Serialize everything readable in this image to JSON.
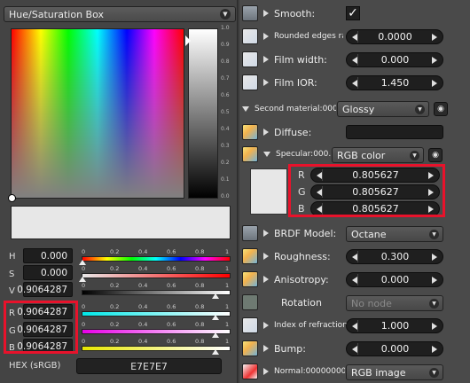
{
  "left": {
    "mode_dropdown": "Hue/Saturation Box",
    "value_ticks": [
      "1.0",
      "0.9",
      "0.8",
      "0.7",
      "0.6",
      "0.5",
      "0.4",
      "0.3",
      "0.2",
      "0.1",
      "0.0"
    ],
    "slider_ticks": [
      "0",
      "0.2",
      "0.4",
      "0.6",
      "0.8",
      "1"
    ],
    "rows": [
      {
        "label": "H",
        "value": "0.000",
        "fraction": 0.0
      },
      {
        "label": "S",
        "value": "0.000",
        "fraction": 0.0
      },
      {
        "label": "V",
        "value": "0.9064287",
        "fraction": 0.906
      },
      {
        "label": "R",
        "value": "0.9064287",
        "fraction": 0.906
      },
      {
        "label": "G",
        "value": "0.9064287",
        "fraction": 0.906
      },
      {
        "label": "B",
        "value": "0.9064287",
        "fraction": 0.906
      }
    ],
    "hex_label": "HEX (sRGB)",
    "hex_value": "E7E7E7",
    "preview_color": "#e7e7e7"
  },
  "right": {
    "smooth": {
      "label": "Smooth:",
      "checked": "✓"
    },
    "rounded_edges": {
      "label": "Rounded edges ra...",
      "value": "0.0000"
    },
    "film_width": {
      "label": "Film width:",
      "value": "0.000"
    },
    "film_ior": {
      "label": "Film IOR:",
      "value": "1.450"
    },
    "second_material": {
      "label": "Second material:0000...",
      "value": "Glossy"
    },
    "diffuse": {
      "label": "Diffuse:"
    },
    "specular": {
      "label": "Specular:000...",
      "value": "RGB color",
      "swatch_color": "#e7e7e7",
      "channels": [
        {
          "label": "R",
          "value": "0.805627"
        },
        {
          "label": "G",
          "value": "0.805627"
        },
        {
          "label": "B",
          "value": "0.805627"
        }
      ]
    },
    "brdf_model": {
      "label": "BRDF Model:",
      "value": "Octane"
    },
    "roughness": {
      "label": "Roughness:",
      "value": "0.300"
    },
    "anisotropy": {
      "label": "Anisotropy:",
      "value": "0.000"
    },
    "rotation": {
      "label": "Rotation",
      "value": "No node"
    },
    "index_of_refraction": {
      "label": "Index of refraction:",
      "value": "1.000"
    },
    "bump": {
      "label": "Bump:",
      "value": "0.000"
    },
    "normal": {
      "label": "Normal:000000001...",
      "value": "RGB image"
    }
  },
  "colors": {
    "highlight": "#e8122b",
    "panel": "#4a4a4a",
    "field": "#1e1e1e"
  }
}
